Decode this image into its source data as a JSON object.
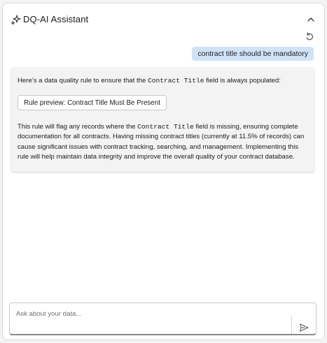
{
  "header": {
    "title": "DQ-AI Assistant",
    "icon": "sparkle-icon",
    "collapse_icon": "chevron-up-icon"
  },
  "toolbar": {
    "undo_icon": "undo-icon"
  },
  "conversation": {
    "user_message": "contract title should be mandatory",
    "assistant": {
      "intro_before": "Here’s a data quality rule to ensure that the ",
      "intro_code": "Contract Title",
      "intro_after": " field is always populated:",
      "rule_button_label": "Rule preview: Contract Title Must Be Present",
      "explain_before": "This rule will flag any records where the ",
      "explain_code": "Contract Title",
      "explain_after": " field is missing, ensuring complete documentation for all contracts. Having missing contract titles (currently at 11.5% of records) can cause significant issues with contract tracking, searching, and management. Implementing this rule will help maintain data integrity and improve the overall quality of your contract database."
    }
  },
  "input": {
    "placeholder": "Ask about your data...",
    "value": "",
    "send_icon": "send-icon"
  },
  "colors": {
    "user_bubble": "#cfe3f8",
    "assistant_card": "#f3f3f3",
    "panel_bg": "#ffffff"
  }
}
